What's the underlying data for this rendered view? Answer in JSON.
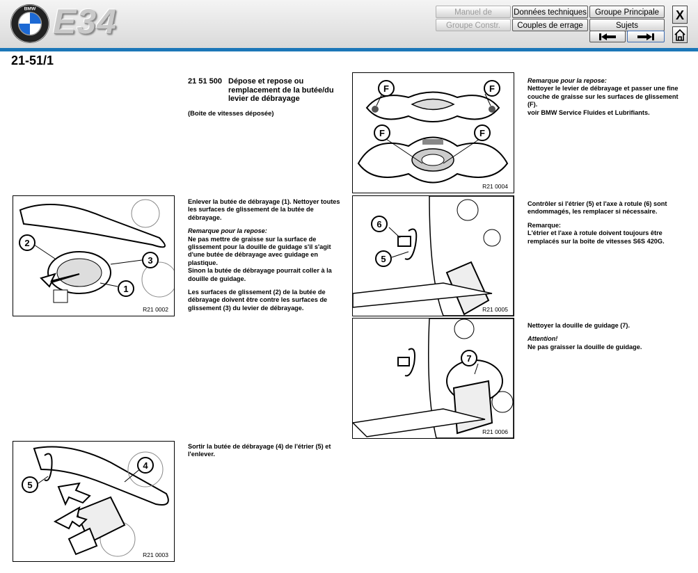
{
  "header": {
    "brand": "E34",
    "logo_text": "BMW",
    "buttons": {
      "manuel": "Manuel de réparation",
      "donnees": "Données techniques",
      "groupe_principal": "Groupe Principale",
      "groupe_constr": "Groupe Constr.",
      "couples": "Couples de errage",
      "sujets": "Sujets"
    },
    "close_label": "X"
  },
  "page": {
    "number": "21-51/1",
    "section_number": "21 51 500",
    "section_title": "Dépose et repose ou remplacement de la butée/du levier de débrayage",
    "subtitle": "(Boite de vitesses déposée)"
  },
  "figures": [
    {
      "id": "R21 0004",
      "labels": [
        "F",
        "F",
        "F",
        "F"
      ]
    },
    {
      "id": "R21 0002",
      "labels": [
        "2",
        "3",
        "1"
      ]
    },
    {
      "id": "R21 0005",
      "labels": [
        "6",
        "5"
      ]
    },
    {
      "id": "R21 0006",
      "labels": [
        "7"
      ]
    },
    {
      "id": "R21 0003",
      "labels": [
        "5",
        "4"
      ]
    }
  ],
  "texts": {
    "note_repose_title": "Remarque pour la repose:",
    "note_repose_body": "Nettoyer le levier de débrayage et passer une fine couche de graisse sur les surfaces de glissement (F).",
    "note_repose_ref": "voir BMW Service Fluides et Lubrifiants.",
    "step1": "Enlever la butée de débrayage (1). Nettoyer toutes les surfaces de glissement de la butée de débrayage.",
    "step1_note_title": "Remarque pour la repose:",
    "step1_note_body": "Ne pas mettre de graisse sur la surface de glissement pour la douille de guidage s'il s'agit d'une butée de débrayage avec guidage en plastique.",
    "step1_note_body2": "Sinon la butée de débrayage pourrait coller à la douille de guidage.",
    "step1_surfaces": "Les surfaces de glissement (2) de la butée de débrayage doivent être contre les surfaces de glissement (3) du levier de débrayage.",
    "step2": "Contrôler si l'étrier (5) et l'axe à rotule (6) sont endommagés, les remplacer si nécessaire.",
    "step2_note_title": "Remarque:",
    "step2_note_body": "L'étrier et l'axe à rotule doivent toujours être remplacés sur la boîte de vitesses S6S 420G.",
    "step3": "Nettoyer la douille de guidage (7).",
    "step3_warn_title": "Attention!",
    "step3_warn_body": "Ne pas graisser la douille de guidage.",
    "step4": "Sortir la butée de débrayage (4) de l'étrier (5) et l'enlever."
  }
}
